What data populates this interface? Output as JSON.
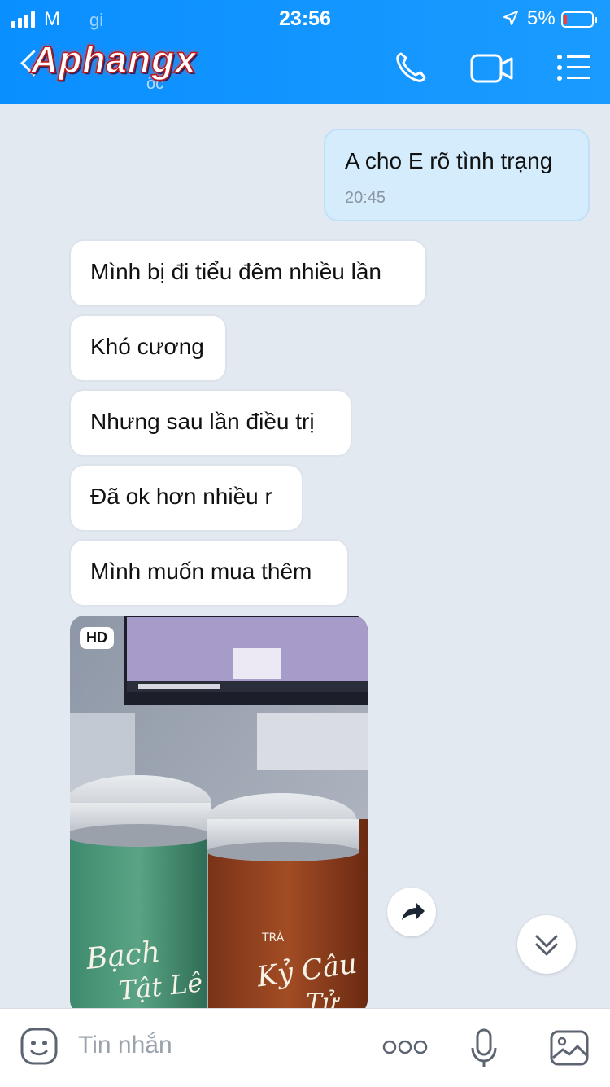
{
  "status_bar": {
    "carrier": "M",
    "time": "23:56",
    "battery_percent": "5%",
    "battery_level": 0.05,
    "signal_bars": 4
  },
  "header": {
    "title": "gi",
    "subtitle": "ốc",
    "logo_text": "Aphangx",
    "icons": [
      "back-icon",
      "phone-icon",
      "video-call-icon",
      "menu-icon"
    ]
  },
  "messages": [
    {
      "direction": "out",
      "text": "A cho E rõ tình trạng",
      "time": "20:45"
    },
    {
      "direction": "in",
      "text": "Mình bị đi tiểu đêm nhiều lần"
    },
    {
      "direction": "in",
      "text": "Khó cương"
    },
    {
      "direction": "in",
      "text": "Nhưng sau lần điều trị"
    },
    {
      "direction": "in",
      "text": "Đã ok hơn nhiều r"
    },
    {
      "direction": "in",
      "text": "Mình muốn mua thêm"
    }
  ],
  "photo": {
    "badge": "HD",
    "label_left": "Bạch Tật Lê",
    "label_right": "Kỷ Câu Tử",
    "label_prefix": "TRÀ"
  },
  "composer": {
    "placeholder": "Tin nhắn",
    "icons": [
      "sticker-icon",
      "more-icon",
      "microphone-icon",
      "image-icon"
    ]
  },
  "colors": {
    "header_bg": "#1a9bff",
    "chat_bg": "#e2e9f1",
    "outgoing_bubble": "#d5ecfd",
    "incoming_bubble": "#ffffff"
  }
}
